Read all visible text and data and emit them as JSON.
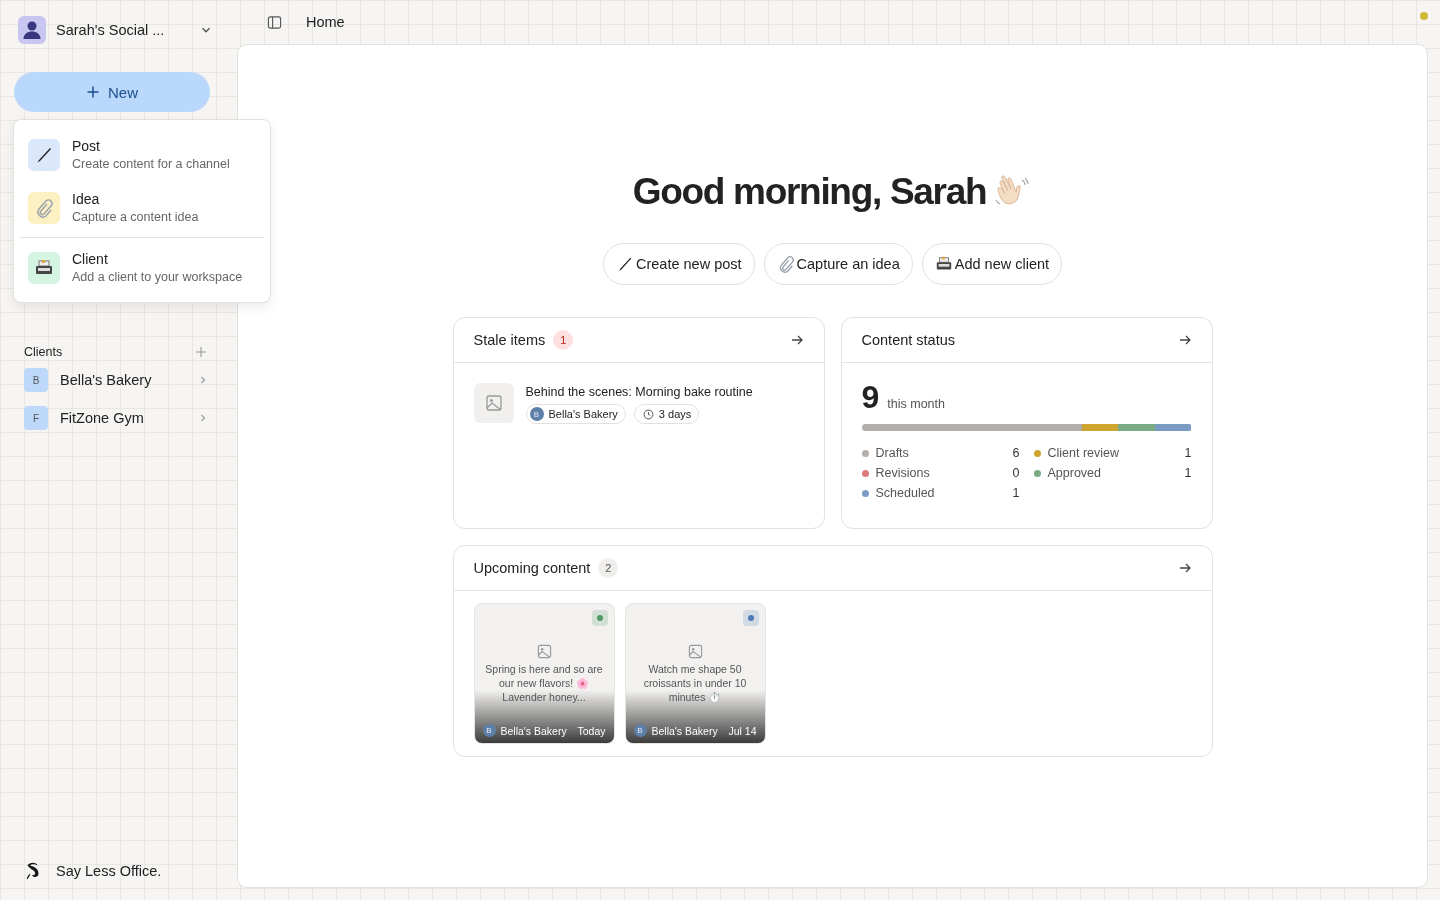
{
  "workspace": {
    "name": "Sarah's Social ..."
  },
  "new_button": {
    "label": "New",
    "expanded": true
  },
  "new_menu": [
    {
      "kind": "post",
      "title": "Post",
      "subtitle": "Create content for a channel"
    },
    {
      "kind": "idea",
      "title": "Idea",
      "subtitle": "Capture a content idea"
    },
    {
      "kind": "client",
      "title": "Client",
      "subtitle": "Add a client to your workspace"
    }
  ],
  "clients": {
    "title": "Clients",
    "items": [
      {
        "initial": "B",
        "name": "Bella's Bakery"
      },
      {
        "initial": "F",
        "name": "FitZone Gym"
      }
    ]
  },
  "brand": "Say Less Office.",
  "breadcrumb": "Home",
  "greeting": "Good morning, Sarah",
  "quick_actions": [
    {
      "kind": "post",
      "label": "Create new post"
    },
    {
      "kind": "idea",
      "label": "Capture an idea"
    },
    {
      "kind": "client",
      "label": "Add new client"
    }
  ],
  "stale": {
    "title": "Stale items",
    "count": "1",
    "items": [
      {
        "title": "Behind the scenes: Morning bake routine",
        "client_initial": "B",
        "client": "Bella's Bakery",
        "age": "3 days"
      }
    ]
  },
  "status": {
    "title": "Content status",
    "total": "9",
    "period": "this month",
    "rows": [
      {
        "label": "Drafts",
        "count": "6",
        "color": "#b3aea9"
      },
      {
        "label": "Client review",
        "count": "1",
        "color": "#cfa52f"
      },
      {
        "label": "Revisions",
        "count": "0",
        "color": "#dc7a78"
      },
      {
        "label": "Approved",
        "count": "1",
        "color": "#7aab84"
      },
      {
        "label": "Scheduled",
        "count": "1",
        "color": "#7a9cc2"
      }
    ]
  },
  "upcoming": {
    "title": "Upcoming content",
    "count": "2",
    "items": [
      {
        "text": "Spring is here and so are our new flavors! 🌸 Lavender honey...",
        "client_initial": "B",
        "client": "Bella's Bakery",
        "date": "Today",
        "color": "#4f9a66"
      },
      {
        "text": "Watch me shape 50 croissants in under 10 minutes ⏱️",
        "client_initial": "B",
        "client": "Bella's Bakery",
        "date": "Jul 14",
        "color": "#4a7bb5"
      }
    ]
  }
}
